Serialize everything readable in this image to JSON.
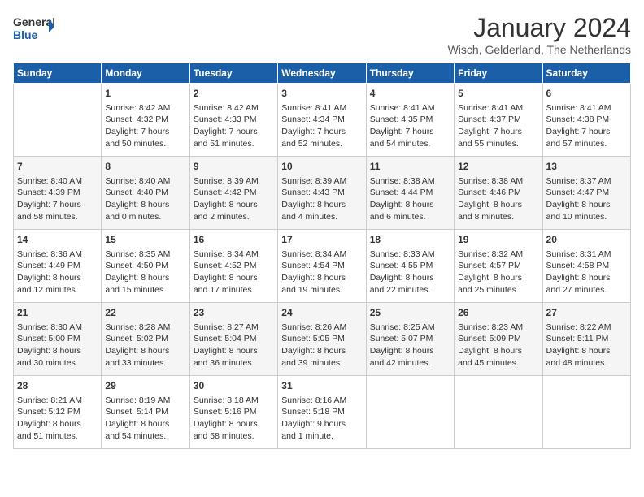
{
  "header": {
    "logo_line1": "General",
    "logo_line2": "Blue",
    "month_title": "January 2024",
    "location": "Wisch, Gelderland, The Netherlands"
  },
  "days_of_week": [
    "Sunday",
    "Monday",
    "Tuesday",
    "Wednesday",
    "Thursday",
    "Friday",
    "Saturday"
  ],
  "weeks": [
    [
      {
        "day": "",
        "info": ""
      },
      {
        "day": "1",
        "info": "Sunrise: 8:42 AM\nSunset: 4:32 PM\nDaylight: 7 hours\nand 50 minutes."
      },
      {
        "day": "2",
        "info": "Sunrise: 8:42 AM\nSunset: 4:33 PM\nDaylight: 7 hours\nand 51 minutes."
      },
      {
        "day": "3",
        "info": "Sunrise: 8:41 AM\nSunset: 4:34 PM\nDaylight: 7 hours\nand 52 minutes."
      },
      {
        "day": "4",
        "info": "Sunrise: 8:41 AM\nSunset: 4:35 PM\nDaylight: 7 hours\nand 54 minutes."
      },
      {
        "day": "5",
        "info": "Sunrise: 8:41 AM\nSunset: 4:37 PM\nDaylight: 7 hours\nand 55 minutes."
      },
      {
        "day": "6",
        "info": "Sunrise: 8:41 AM\nSunset: 4:38 PM\nDaylight: 7 hours\nand 57 minutes."
      }
    ],
    [
      {
        "day": "7",
        "info": "Sunrise: 8:40 AM\nSunset: 4:39 PM\nDaylight: 7 hours\nand 58 minutes."
      },
      {
        "day": "8",
        "info": "Sunrise: 8:40 AM\nSunset: 4:40 PM\nDaylight: 8 hours\nand 0 minutes."
      },
      {
        "day": "9",
        "info": "Sunrise: 8:39 AM\nSunset: 4:42 PM\nDaylight: 8 hours\nand 2 minutes."
      },
      {
        "day": "10",
        "info": "Sunrise: 8:39 AM\nSunset: 4:43 PM\nDaylight: 8 hours\nand 4 minutes."
      },
      {
        "day": "11",
        "info": "Sunrise: 8:38 AM\nSunset: 4:44 PM\nDaylight: 8 hours\nand 6 minutes."
      },
      {
        "day": "12",
        "info": "Sunrise: 8:38 AM\nSunset: 4:46 PM\nDaylight: 8 hours\nand 8 minutes."
      },
      {
        "day": "13",
        "info": "Sunrise: 8:37 AM\nSunset: 4:47 PM\nDaylight: 8 hours\nand 10 minutes."
      }
    ],
    [
      {
        "day": "14",
        "info": "Sunrise: 8:36 AM\nSunset: 4:49 PM\nDaylight: 8 hours\nand 12 minutes."
      },
      {
        "day": "15",
        "info": "Sunrise: 8:35 AM\nSunset: 4:50 PM\nDaylight: 8 hours\nand 15 minutes."
      },
      {
        "day": "16",
        "info": "Sunrise: 8:34 AM\nSunset: 4:52 PM\nDaylight: 8 hours\nand 17 minutes."
      },
      {
        "day": "17",
        "info": "Sunrise: 8:34 AM\nSunset: 4:54 PM\nDaylight: 8 hours\nand 19 minutes."
      },
      {
        "day": "18",
        "info": "Sunrise: 8:33 AM\nSunset: 4:55 PM\nDaylight: 8 hours\nand 22 minutes."
      },
      {
        "day": "19",
        "info": "Sunrise: 8:32 AM\nSunset: 4:57 PM\nDaylight: 8 hours\nand 25 minutes."
      },
      {
        "day": "20",
        "info": "Sunrise: 8:31 AM\nSunset: 4:58 PM\nDaylight: 8 hours\nand 27 minutes."
      }
    ],
    [
      {
        "day": "21",
        "info": "Sunrise: 8:30 AM\nSunset: 5:00 PM\nDaylight: 8 hours\nand 30 minutes."
      },
      {
        "day": "22",
        "info": "Sunrise: 8:28 AM\nSunset: 5:02 PM\nDaylight: 8 hours\nand 33 minutes."
      },
      {
        "day": "23",
        "info": "Sunrise: 8:27 AM\nSunset: 5:04 PM\nDaylight: 8 hours\nand 36 minutes."
      },
      {
        "day": "24",
        "info": "Sunrise: 8:26 AM\nSunset: 5:05 PM\nDaylight: 8 hours\nand 39 minutes."
      },
      {
        "day": "25",
        "info": "Sunrise: 8:25 AM\nSunset: 5:07 PM\nDaylight: 8 hours\nand 42 minutes."
      },
      {
        "day": "26",
        "info": "Sunrise: 8:23 AM\nSunset: 5:09 PM\nDaylight: 8 hours\nand 45 minutes."
      },
      {
        "day": "27",
        "info": "Sunrise: 8:22 AM\nSunset: 5:11 PM\nDaylight: 8 hours\nand 48 minutes."
      }
    ],
    [
      {
        "day": "28",
        "info": "Sunrise: 8:21 AM\nSunset: 5:12 PM\nDaylight: 8 hours\nand 51 minutes."
      },
      {
        "day": "29",
        "info": "Sunrise: 8:19 AM\nSunset: 5:14 PM\nDaylight: 8 hours\nand 54 minutes."
      },
      {
        "day": "30",
        "info": "Sunrise: 8:18 AM\nSunset: 5:16 PM\nDaylight: 8 hours\nand 58 minutes."
      },
      {
        "day": "31",
        "info": "Sunrise: 8:16 AM\nSunset: 5:18 PM\nDaylight: 9 hours\nand 1 minute."
      },
      {
        "day": "",
        "info": ""
      },
      {
        "day": "",
        "info": ""
      },
      {
        "day": "",
        "info": ""
      }
    ]
  ]
}
